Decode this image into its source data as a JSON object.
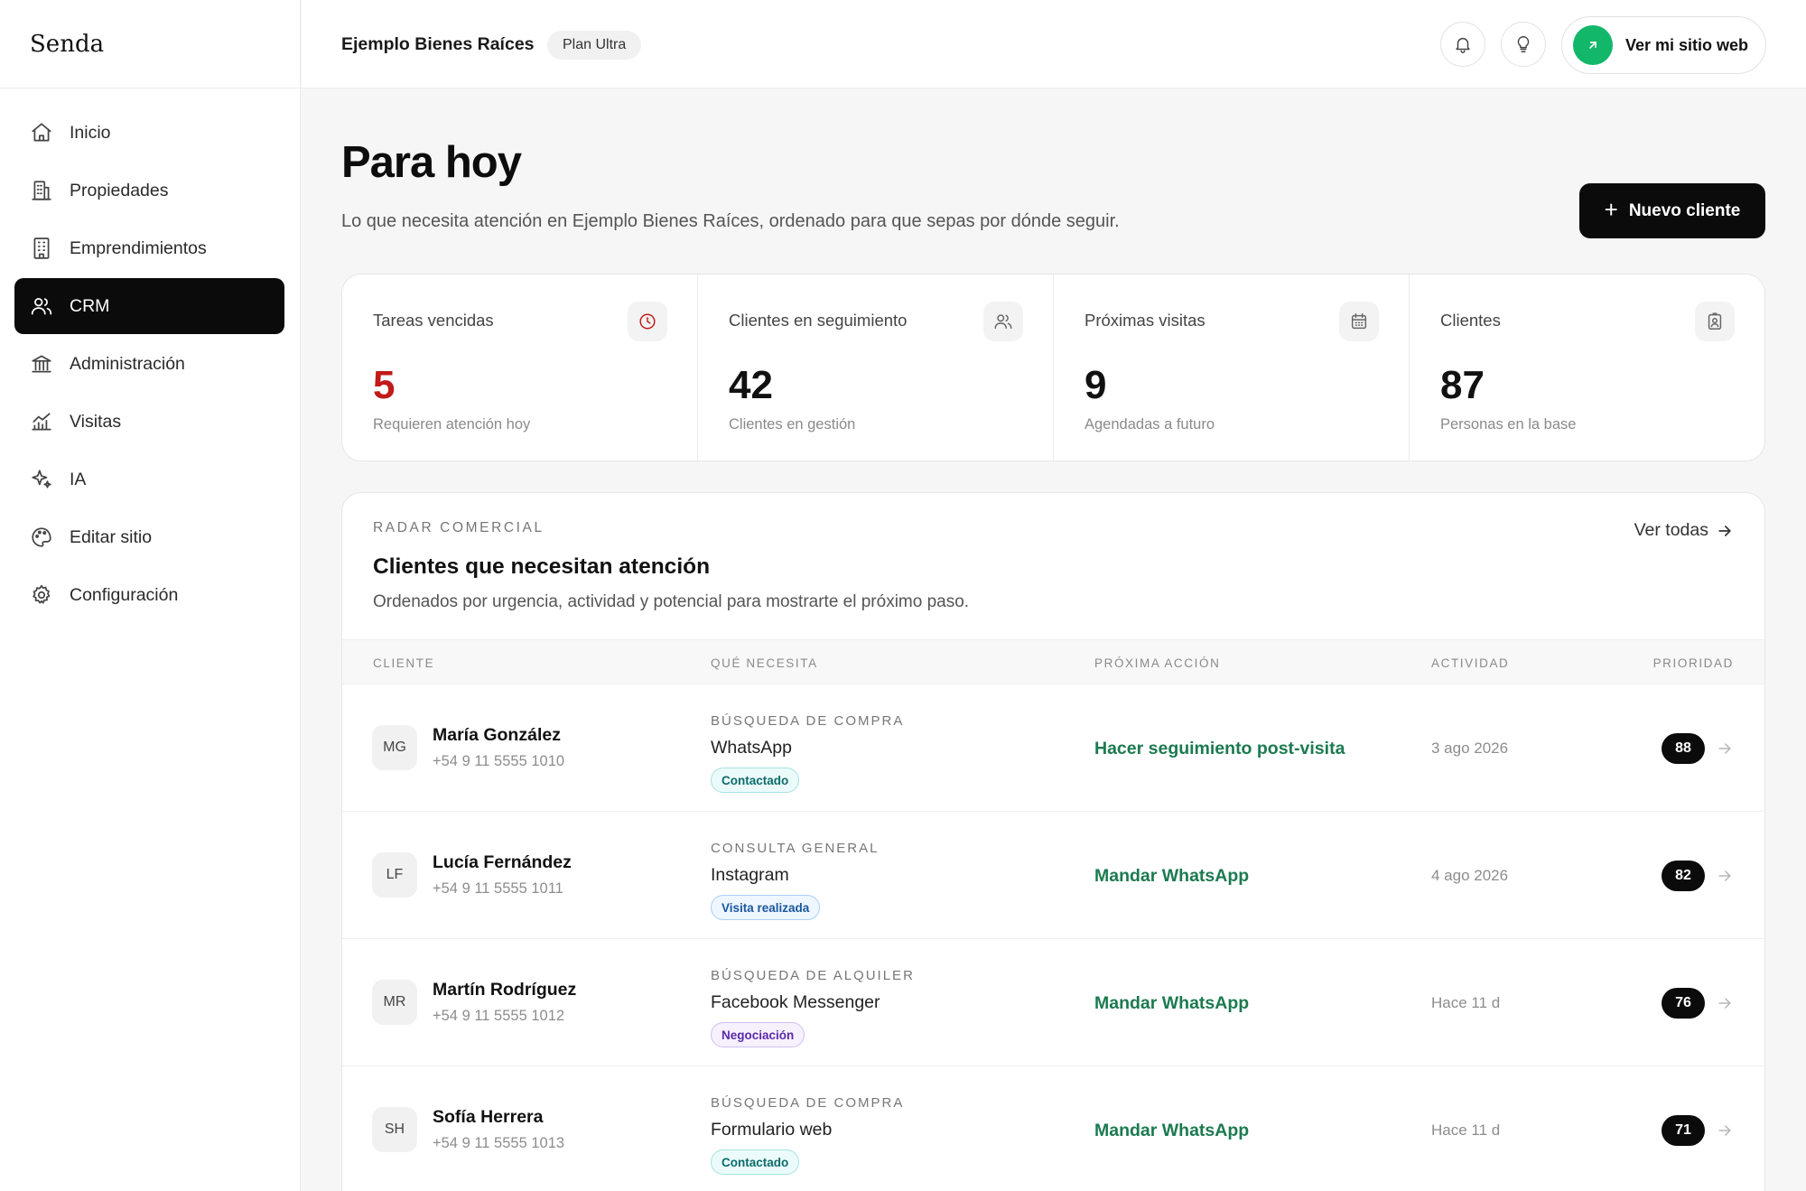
{
  "brand": {
    "name": "Senda"
  },
  "sidebar": {
    "items": [
      {
        "label": "Inicio",
        "icon": "home-icon",
        "active": false
      },
      {
        "label": "Propiedades",
        "icon": "building-icon",
        "active": false
      },
      {
        "label": "Emprendimientos",
        "icon": "tower-icon",
        "active": false
      },
      {
        "label": "CRM",
        "icon": "users-icon",
        "active": true
      },
      {
        "label": "Administración",
        "icon": "bank-icon",
        "active": false
      },
      {
        "label": "Visitas",
        "icon": "chart-icon",
        "active": false
      },
      {
        "label": "IA",
        "icon": "sparkles-icon",
        "active": false
      },
      {
        "label": "Editar sitio",
        "icon": "palette-icon",
        "active": false
      },
      {
        "label": "Configuración",
        "icon": "gear-icon",
        "active": false
      }
    ]
  },
  "header": {
    "company": "Ejemplo Bienes Raíces",
    "plan": "Plan Ultra",
    "site_button": "Ver mi sitio web"
  },
  "page": {
    "title": "Para hoy",
    "subtitle": "Lo que necesita atención en Ejemplo Bienes Raíces, ordenado para que sepas por dónde seguir.",
    "new_client_label": "Nuevo cliente"
  },
  "stats": [
    {
      "label": "Tareas vencidas",
      "value": "5",
      "sub": "Requieren atención hoy",
      "icon": "clock-icon"
    },
    {
      "label": "Clientes en seguimiento",
      "value": "42",
      "sub": "Clientes en gestión",
      "icon": "users-icon"
    },
    {
      "label": "Próximas visitas",
      "value": "9",
      "sub": "Agendadas a futuro",
      "icon": "calendar-icon"
    },
    {
      "label": "Clientes",
      "value": "87",
      "sub": "Personas en la base",
      "icon": "contact-icon"
    }
  ],
  "radar": {
    "eyebrow": "RADAR COMERCIAL",
    "title": "Clientes que necesitan atención",
    "description": "Ordenados por urgencia, actividad y potencial para mostrarte el próximo paso.",
    "see_all": "Ver todas",
    "columns": [
      "CLIENTE",
      "QUÉ NECESITA",
      "PRÓXIMA ACCIÓN",
      "ACTIVIDAD",
      "PRIORIDAD"
    ],
    "rows": [
      {
        "initials": "MG",
        "name": "María González",
        "phone": "+54 9 11 5555 1010",
        "need_type": "BÚSQUEDA DE COMPRA",
        "channel": "WhatsApp",
        "tag": "Contactado",
        "action": "Hacer seguimiento post-visita",
        "activity": "3 ago 2026",
        "priority": "88"
      },
      {
        "initials": "LF",
        "name": "Lucía Fernández",
        "phone": "+54 9 11 5555 1011",
        "need_type": "CONSULTA GENERAL",
        "channel": "Instagram",
        "tag": "Visita realizada",
        "action": "Mandar WhatsApp",
        "activity": "4 ago 2026",
        "priority": "82"
      },
      {
        "initials": "MR",
        "name": "Martín Rodríguez",
        "phone": "+54 9 11 5555 1012",
        "need_type": "BÚSQUEDA DE ALQUILER",
        "channel": "Facebook Messenger",
        "tag": "Negociación",
        "action": "Mandar WhatsApp",
        "activity": "Hace 11 d",
        "priority": "76"
      },
      {
        "initials": "SH",
        "name": "Sofía Herrera",
        "phone": "+54 9 11 5555 1013",
        "need_type": "BÚSQUEDA DE COMPRA",
        "channel": "Formulario web",
        "tag": "Contactado",
        "action": "Mandar WhatsApp",
        "activity": "Hace 11 d",
        "priority": "71"
      }
    ]
  },
  "colors": {
    "accent": "#12b76a",
    "action_green": "#1b7a4f",
    "overdue_red": "#c11a1a",
    "active_nav": "#0b0b0b"
  }
}
